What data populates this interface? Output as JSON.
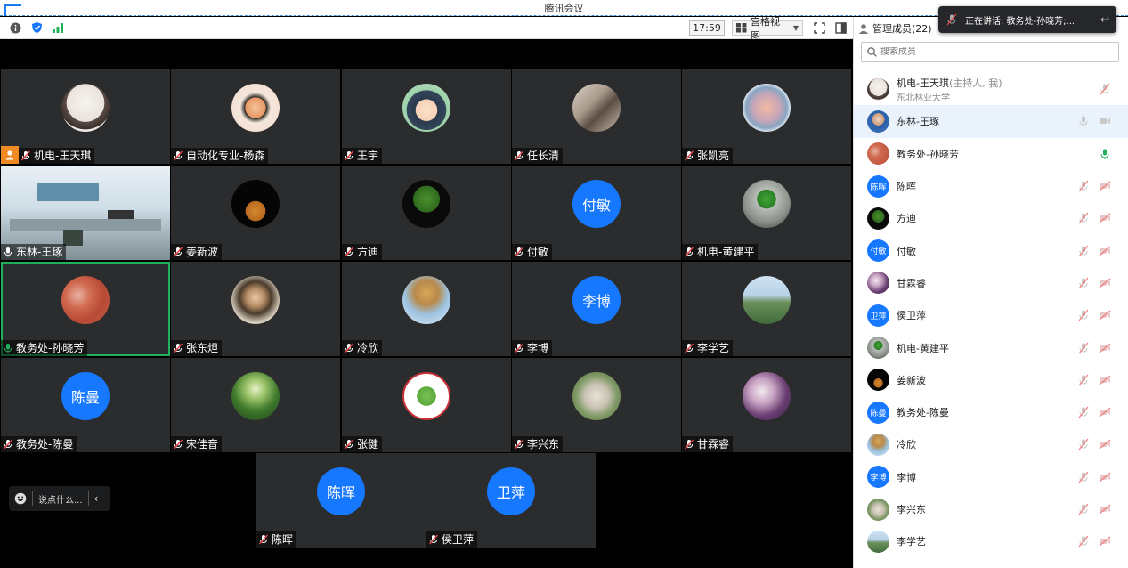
{
  "window": {
    "title": "腾讯会议"
  },
  "toolbar": {
    "time": "17:59",
    "view_label": "宫格视图"
  },
  "colors": {
    "accent": "#1677ff",
    "active_speaker": "#1fb25a",
    "host_badge": "#f08a24",
    "tile_bg": "#2b2c2e"
  },
  "tiles": [
    {
      "name": "机电-王天琪",
      "avatar": "photo"
    },
    {
      "name": "自动化专业-杨森",
      "avatar": "photo"
    },
    {
      "name": "王宇",
      "avatar": "photo"
    },
    {
      "name": "任长清",
      "avatar": "photo"
    },
    {
      "name": "张凯亮",
      "avatar": "photo"
    },
    {
      "name": "东林-王琢",
      "avatar": "video"
    },
    {
      "name": "姜新波",
      "avatar": "photo"
    },
    {
      "name": "方迪",
      "avatar": "photo"
    },
    {
      "name": "付敏",
      "avatar_text": "付敏"
    },
    {
      "name": "机电-黄建平",
      "avatar": "photo"
    },
    {
      "name": "教务处-孙晓芳",
      "avatar": "photo"
    },
    {
      "name": "张东炟",
      "avatar": "photo"
    },
    {
      "name": "冷欣",
      "avatar": "photo"
    },
    {
      "name": "李博",
      "avatar_text": "李博"
    },
    {
      "name": "李学艺",
      "avatar": "photo"
    },
    {
      "name": "教务处-陈曼",
      "avatar_text": "陈曼"
    },
    {
      "name": "宋佳音",
      "avatar": "photo"
    },
    {
      "name": "张健",
      "avatar": "photo"
    },
    {
      "name": "李兴东",
      "avatar": "photo"
    },
    {
      "name": "甘霖睿",
      "avatar": "photo"
    },
    {
      "name": "陈晖",
      "avatar_text": "陈晖"
    },
    {
      "name": "侯卫萍",
      "avatar_text": "卫萍"
    }
  ],
  "chat": {
    "placeholder": "说点什么..."
  },
  "panel": {
    "title": "管理成员(22)",
    "search_placeholder": "搜索成员",
    "members": [
      {
        "name": "机电-王天琪",
        "role": "(主持人, 我)",
        "sub": "东北林业大学"
      },
      {
        "name": "东林-王琢"
      },
      {
        "name": "教务处-孙晓芳"
      },
      {
        "name": "陈晖",
        "avatar_text": "陈晖"
      },
      {
        "name": "方迪"
      },
      {
        "name": "付敏",
        "avatar_text": "付敏"
      },
      {
        "name": "甘霖睿"
      },
      {
        "name": "侯卫萍",
        "avatar_text": "卫萍"
      },
      {
        "name": "机电-黄建平"
      },
      {
        "name": "姜新波"
      },
      {
        "name": "教务处-陈曼",
        "avatar_text": "陈曼"
      },
      {
        "name": "冷欣"
      },
      {
        "name": "李博",
        "avatar_text": "李博"
      },
      {
        "name": "李兴东"
      },
      {
        "name": "李学艺"
      }
    ]
  },
  "speaking": {
    "text": "正在讲话: 教务处-孙晓芳;..."
  }
}
